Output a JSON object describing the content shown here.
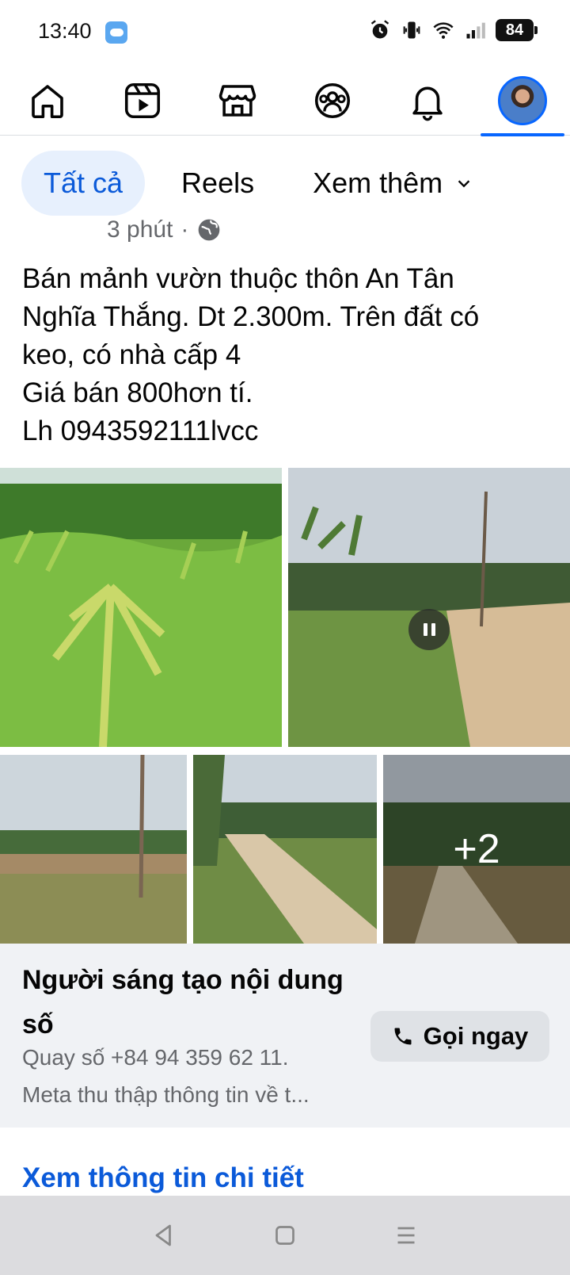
{
  "status_bar": {
    "time": "13:40",
    "battery": "84",
    "icons": [
      "weather-icon",
      "alarm-icon",
      "vibrate-icon",
      "wifi-icon",
      "signal-icon",
      "battery-icon"
    ]
  },
  "top_nav": {
    "items": [
      "home-icon",
      "video-icon",
      "marketplace-icon",
      "groups-icon",
      "notifications-icon",
      "profile-avatar"
    ],
    "active_index": 5,
    "accent": "#0866ff"
  },
  "filters": {
    "all": "Tất cả",
    "reels": "Reels",
    "more": "Xem thêm"
  },
  "post": {
    "time": "3 phút",
    "separator": "·",
    "lines": [
      "Bán mảnh vườn thuộc thôn An Tân",
      "Nghĩa Thắng. Dt 2.300m. Trên đất có",
      "keo, có nhà cấp 4",
      "Giá bán 800hơn tí.",
      "Lh 0943592111lvcc"
    ],
    "extra_media": "+2"
  },
  "cta": {
    "title": "Người sáng tạo nội dung số",
    "subtitle": "Quay số +84 94 359 62 11.",
    "disclaimer": "Meta thu thập thông tin về t...",
    "call_label": "Gọi ngay",
    "detail_link": "Xem thông tin chi tiết"
  },
  "colors": {
    "link": "#0b5ad9",
    "chip_active_bg": "#e7f0fd",
    "cta_bg": "#f0f2f5"
  }
}
